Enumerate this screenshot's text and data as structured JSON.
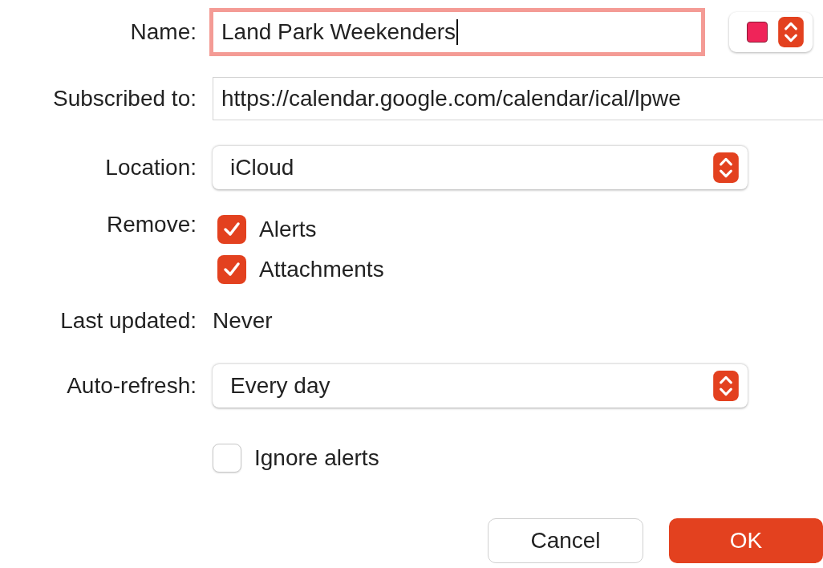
{
  "name": {
    "label": "Name:",
    "value": "Land Park Weekenders",
    "focused": true
  },
  "color_well": {
    "color": "#ef2459"
  },
  "subscribed": {
    "label": "Subscribed to:",
    "value": "https://calendar.google.com/calendar/ical/lpwe"
  },
  "location": {
    "label": "Location:",
    "value": "iCloud"
  },
  "remove": {
    "label": "Remove:",
    "options": [
      {
        "label": "Alerts",
        "checked": true
      },
      {
        "label": "Attachments",
        "checked": true
      }
    ]
  },
  "last_updated": {
    "label": "Last updated:",
    "value": "Never"
  },
  "auto_refresh": {
    "label": "Auto-refresh:",
    "value": "Every day"
  },
  "ignore_alerts": {
    "label": "Ignore alerts",
    "checked": false
  },
  "buttons": [
    {
      "label": "Cancel",
      "kind": "secondary"
    },
    {
      "label": "OK",
      "kind": "primary"
    }
  ]
}
